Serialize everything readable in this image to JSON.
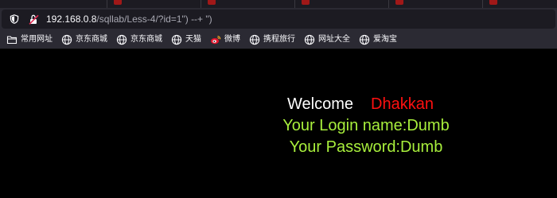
{
  "browser": {
    "address_bar": {
      "host": "192.168.0.8",
      "path": "/sqllab/Less-4/?id=1\") --+ \")"
    },
    "bookmarks": [
      {
        "label": "常用网址",
        "icon": "folder-icon"
      },
      {
        "label": "京东商城",
        "icon": "globe-icon"
      },
      {
        "label": "京东商城",
        "icon": "globe-icon"
      },
      {
        "label": "天猫",
        "icon": "globe-icon"
      },
      {
        "label": "微博",
        "icon": "weibo-icon"
      },
      {
        "label": "携程旅行",
        "icon": "globe-icon"
      },
      {
        "label": "网址大全",
        "icon": "globe-icon"
      },
      {
        "label": "爱淘宝",
        "icon": "globe-icon"
      }
    ]
  },
  "page": {
    "welcome": "Welcome",
    "username": "Dhakkan",
    "login_name": "Your Login name:Dumb",
    "password": "Your Password:Dumb"
  },
  "colors": {
    "welcome": "#ffffff",
    "username": "#ff1010",
    "result_text": "#a8ef3c",
    "background": "#000000"
  }
}
